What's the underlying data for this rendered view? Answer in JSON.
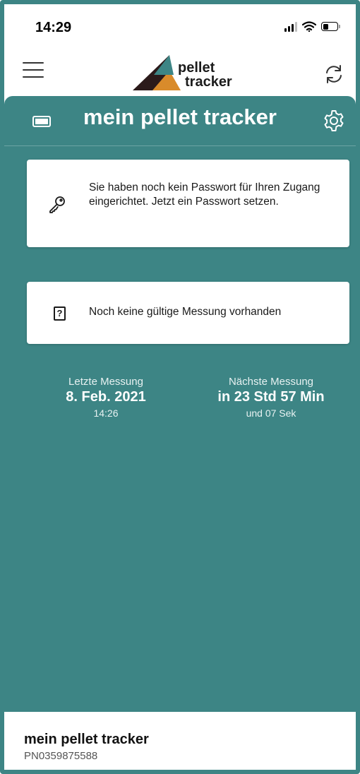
{
  "status_bar": {
    "time": "14:29",
    "icons": [
      "signal-icon",
      "wifi-icon",
      "battery-icon"
    ]
  },
  "header": {
    "menu_icon": "hamburger-menu-icon",
    "logo": {
      "line1": "pellet",
      "line2": "tracker",
      "colors": [
        "#3d8585",
        "#d98b2b",
        "#2b1a1a"
      ]
    },
    "refresh_icon": "refresh-icon"
  },
  "panel": {
    "title": "mein pellet tracker",
    "battery_icon": "battery-full-icon",
    "settings_icon": "gear-icon",
    "background_color": "#3d8585"
  },
  "password_card": {
    "icon": "key-icon",
    "text": "Sie haben noch kein Passwort für Ihren Zugang eingerichtet. Jetzt ein Passwort setzen."
  },
  "measurement_card": {
    "icon": "question-mark-icon",
    "icon_glyph": "?",
    "text": "Noch keine gültige Messung vorhanden"
  },
  "last_measurement": {
    "label": "Letzte Messung",
    "date": "8. Feb. 2021",
    "time": "14:26"
  },
  "next_measurement": {
    "label": "Nächste Messung",
    "value": "in 23 Std 57 Min",
    "sub": "und 07 Sek"
  },
  "device": {
    "name": "mein pellet tracker",
    "serial": "PN0359875588"
  }
}
